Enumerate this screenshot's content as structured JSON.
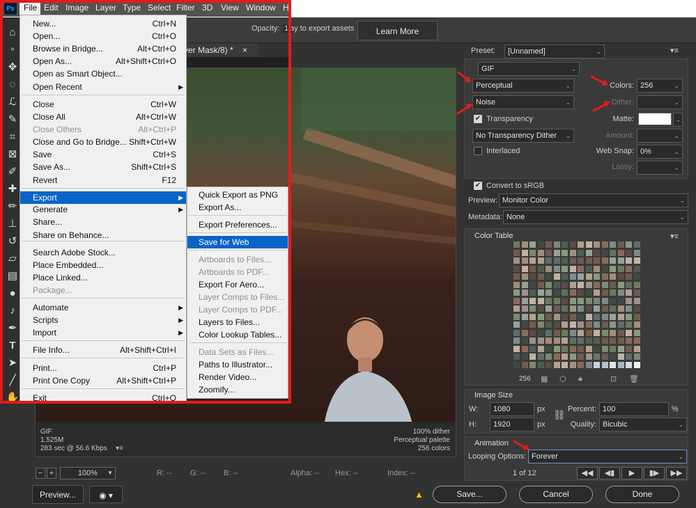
{
  "menubar": {
    "app_icon": "Ps",
    "items": [
      "File",
      "Edit",
      "Image",
      "Layer",
      "Type",
      "Select",
      "Filter",
      "3D",
      "View",
      "Window",
      "H"
    ]
  },
  "options_bar": {
    "opacity_label": "Opacity:",
    "opacity_value": "1(",
    "export_hint": "ay to export assets",
    "learn_more": "Learn More"
  },
  "document_tab": {
    "title": "yer Mask/8) *",
    "close": "×"
  },
  "file_menu": {
    "items": [
      {
        "label": "New...",
        "shortcut": "Ctrl+N"
      },
      {
        "label": "Open...",
        "shortcut": "Ctrl+O"
      },
      {
        "label": "Browse in Bridge...",
        "shortcut": "Alt+Ctrl+O"
      },
      {
        "label": "Open As...",
        "shortcut": "Alt+Shift+Ctrl+O"
      },
      {
        "label": "Open as Smart Object...",
        "shortcut": ""
      },
      {
        "label": "Open Recent",
        "shortcut": ""
      },
      {
        "label": "Close",
        "shortcut": "Ctrl+W"
      },
      {
        "label": "Close All",
        "shortcut": "Alt+Ctrl+W"
      },
      {
        "label": "Close Others",
        "shortcut": "Alt+Ctrl+P"
      },
      {
        "label": "Close and Go to Bridge...",
        "shortcut": "Shift+Ctrl+W"
      },
      {
        "label": "Save",
        "shortcut": "Ctrl+S"
      },
      {
        "label": "Save As...",
        "shortcut": "Shift+Ctrl+S"
      },
      {
        "label": "Revert",
        "shortcut": "F12"
      },
      {
        "label": "Export",
        "shortcut": ""
      },
      {
        "label": "Generate",
        "shortcut": ""
      },
      {
        "label": "Share...",
        "shortcut": ""
      },
      {
        "label": "Share on Behance...",
        "shortcut": ""
      },
      {
        "label": "Search Adobe Stock...",
        "shortcut": ""
      },
      {
        "label": "Place Embedded...",
        "shortcut": ""
      },
      {
        "label": "Place Linked...",
        "shortcut": ""
      },
      {
        "label": "Package...",
        "shortcut": ""
      },
      {
        "label": "Automate",
        "shortcut": ""
      },
      {
        "label": "Scripts",
        "shortcut": ""
      },
      {
        "label": "Import",
        "shortcut": ""
      },
      {
        "label": "File Info...",
        "shortcut": "Alt+Shift+Ctrl+I"
      },
      {
        "label": "Print...",
        "shortcut": "Ctrl+P"
      },
      {
        "label": "Print One Copy",
        "shortcut": "Alt+Shift+Ctrl+P"
      },
      {
        "label": "Exit",
        "shortcut": "Ctrl+Q"
      }
    ]
  },
  "export_submenu": {
    "items": [
      "Quick Export as PNG",
      "Export As...",
      "Export Preferences...",
      "Save for Web (Legacy)...",
      "Artboards to Files...",
      "Artboards to PDF...",
      "Export For Aero...",
      "Layer Comps to Files...",
      "Layer Comps to PDF...",
      "Layers to Files...",
      "Color Lookup Tables...",
      "Data Sets as Files...",
      "Paths to Illustrator...",
      "Render Video...",
      "Zoomify..."
    ]
  },
  "doc_info": {
    "format": "GIF",
    "size": "1.525M",
    "time": "283 sec @ 56.6 Kbps",
    "dither": "100% dither",
    "palette": "Perceptual palette",
    "colors": "256 colors"
  },
  "status": {
    "zoom": "100%",
    "r": "R: --",
    "g": "G: --",
    "b": "B: --",
    "alpha": "Alpha: --",
    "hex": "Hex: --",
    "index": "Index: --"
  },
  "buttons": {
    "preview": "Preview...",
    "save": "Save...",
    "cancel": "Cancel",
    "done": "Done"
  },
  "settings": {
    "preset_label": "Preset:",
    "preset_value": "[Unnamed]",
    "format": "GIF",
    "reduction": "Perceptual",
    "dither_algo": "Noise",
    "colors_label": "Colors:",
    "colors_value": "256",
    "dither_label": "Dither:",
    "transparency_label": "Transparency",
    "matte_label": "Matte:",
    "transparency_dither": "No Transparency Dither",
    "amount_label": "Amount:",
    "interlaced_label": "Interlaced",
    "websnap_label": "Web Snap:",
    "websnap_value": "0%",
    "lossy_label": "Lossy:",
    "convert_srgb": "Convert to sRGB",
    "preview_label": "Preview:",
    "preview_value": "Monitor Color",
    "metadata_label": "Metadata:",
    "metadata_value": "None"
  },
  "color_table": {
    "title": "Color Table",
    "count": "256"
  },
  "image_size": {
    "title": "Image Size",
    "w_label": "W:",
    "w_value": "1080",
    "h_label": "H:",
    "h_value": "1920",
    "unit": "px",
    "percent_label": "Percent:",
    "percent_value": "100",
    "percent_unit": "%",
    "quality_label": "Quality:",
    "quality_value": "Bicubic"
  },
  "animation": {
    "title": "Animation",
    "looping_label": "Looping Options:",
    "looping_value": "Forever",
    "frame": "1 of 12"
  },
  "colors": {
    "highlight": "#0a64c8",
    "annotation_red": "#e41b1b"
  }
}
